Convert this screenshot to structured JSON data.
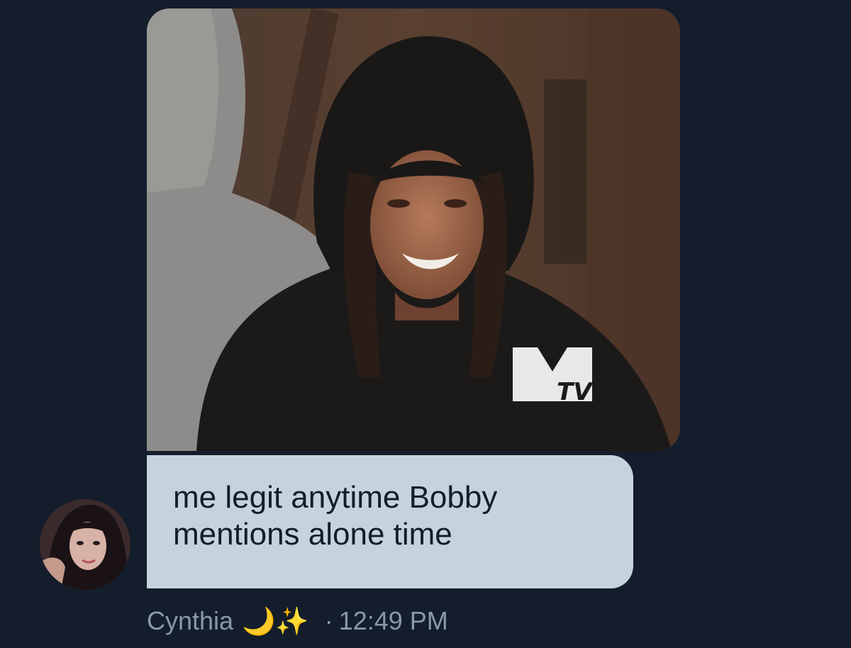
{
  "message": {
    "line1": "me legit anytime Bobby",
    "line2": "mentions alone time",
    "sender_name": "Cynthia",
    "sender_emoji": "🌙✨",
    "separator": "·",
    "timestamp": "12:49 PM"
  },
  "media": {
    "watermark_text": "MTV"
  },
  "colors": {
    "background": "#141d2b",
    "bubble": "#c6d3df",
    "bubble_text": "#141d2b",
    "meta_text": "#8899a8"
  }
}
